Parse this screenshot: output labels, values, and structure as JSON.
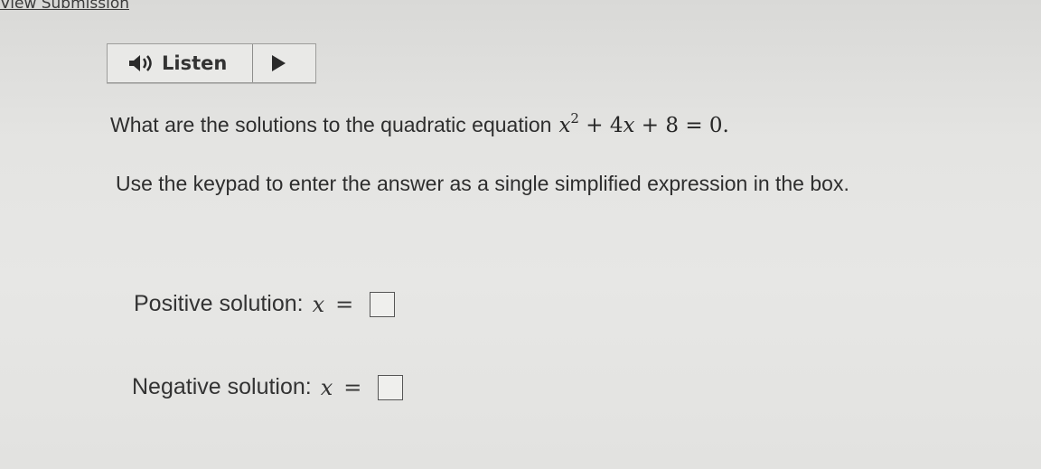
{
  "header": {
    "view_submission": "View Submission"
  },
  "audio": {
    "listen_label": "Listen",
    "speaker_icon": "speaker-icon",
    "play_icon": "play-icon"
  },
  "question": {
    "prompt": "What are the solutions to the quadratic equation",
    "equation": {
      "var": "x",
      "exp": "2",
      "plus1": " + 4",
      "var2": "x",
      "plus2": " + 8 = 0."
    }
  },
  "instruction": "Use the keypad to enter the answer as a single simplified expression in the box.",
  "answers": [
    {
      "label": "Positive solution:",
      "variable": "x",
      "equals": "=",
      "value": ""
    },
    {
      "label": "Negative solution:",
      "variable": "x",
      "equals": "=",
      "value": ""
    }
  ]
}
